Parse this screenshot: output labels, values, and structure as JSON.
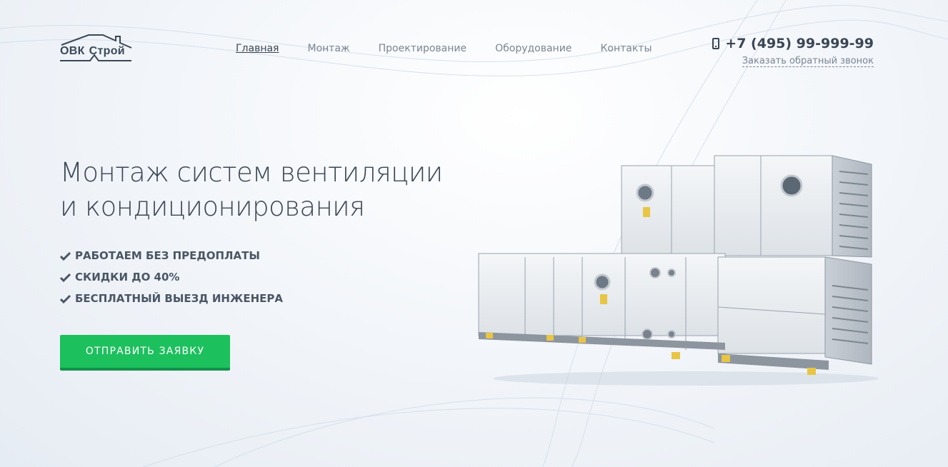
{
  "logo": {
    "text_part1": "ОВК",
    "text_part2": "Строй"
  },
  "nav": {
    "items": [
      {
        "label": "Главная",
        "active": true
      },
      {
        "label": "Монтаж",
        "active": false
      },
      {
        "label": "Проектирование",
        "active": false
      },
      {
        "label": "Оборудование",
        "active": false
      },
      {
        "label": "Контакты",
        "active": false
      }
    ]
  },
  "contact": {
    "phone_icon": "mobile-phone-icon",
    "phone": "+7 (495) 99-999-99",
    "callback": "Заказать обратный звонок"
  },
  "hero": {
    "title_line1": "Монтаж систем вентиляции",
    "title_line2": "и кондиционирования",
    "features": [
      "РАБОТАЕМ БЕЗ ПРЕДОПЛАТЫ",
      "СКИДКИ ДО 40%",
      "БЕСПЛАТНЫЙ ВЫЕЗД ИНЖЕНЕРА"
    ],
    "cta_label": "ОТПРАВИТЬ ЗАЯВКУ"
  },
  "colors": {
    "accent": "#1cc05d",
    "text": "#3a4654",
    "muted": "#7a8593"
  }
}
